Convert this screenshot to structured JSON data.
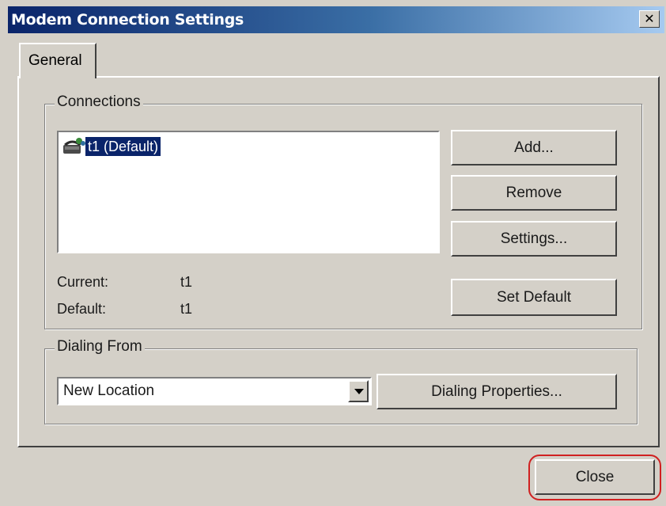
{
  "window": {
    "title": "Modem Connection Settings",
    "close_glyph": "✕"
  },
  "tabs": [
    {
      "label": "General",
      "selected": true
    }
  ],
  "connections": {
    "group_label": "Connections",
    "items": [
      {
        "label": "t1 (Default)",
        "icon": "modem-phone-icon",
        "selected": true
      }
    ],
    "buttons": {
      "add": "Add...",
      "remove": "Remove",
      "settings": "Settings...",
      "set_default": "Set Default"
    },
    "current_label": "Current:",
    "current_value": "t1",
    "default_label": "Default:",
    "default_value": "t1"
  },
  "dialing": {
    "group_label": "Dialing From",
    "location": "New Location",
    "properties_button": "Dialing Properties..."
  },
  "footer": {
    "close_button": "Close"
  },
  "colors": {
    "face": "#d4d0c8",
    "title_dark": "#0a246a",
    "selection": "#0a246a",
    "annotation": "#d02020"
  }
}
